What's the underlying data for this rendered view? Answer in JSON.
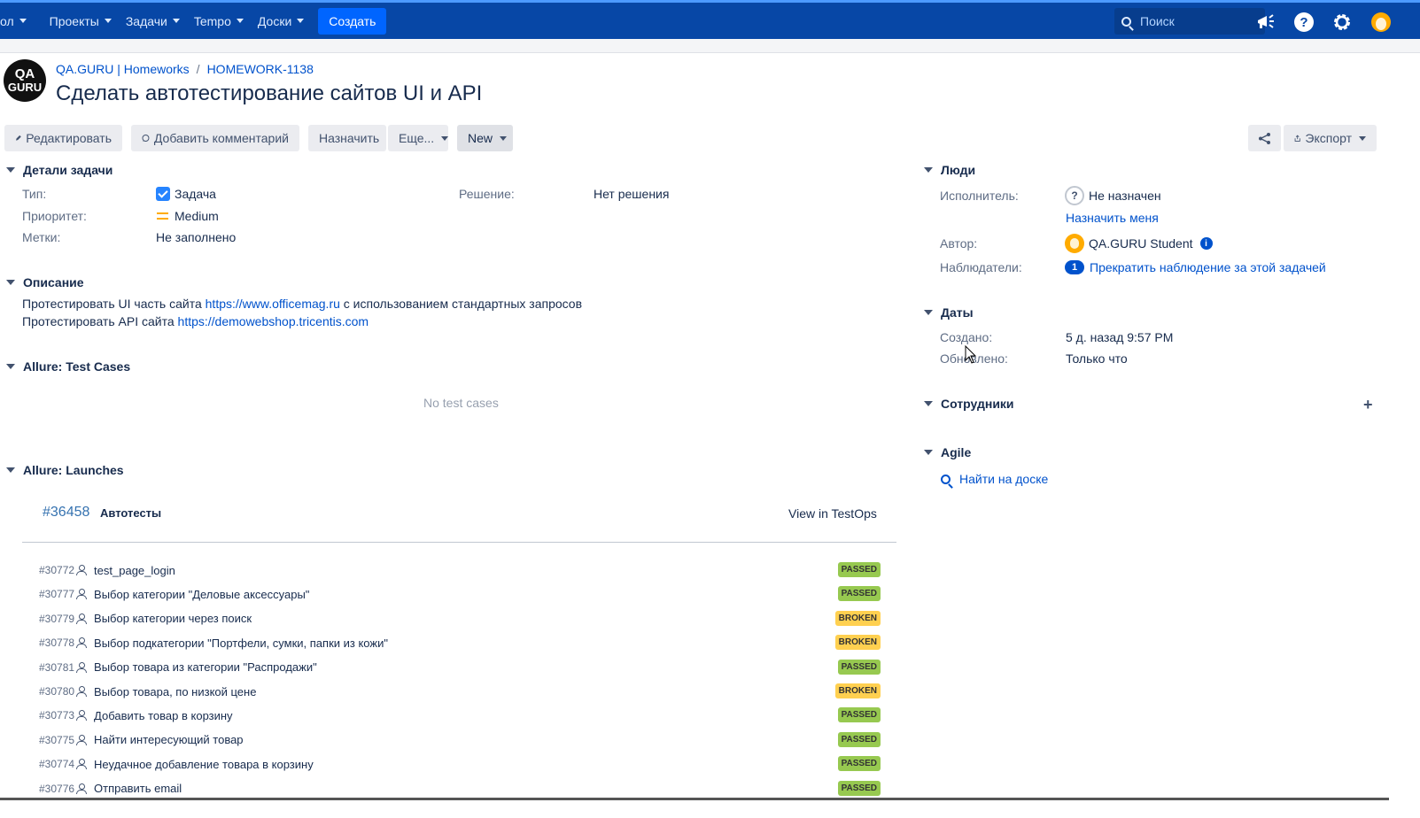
{
  "nav": {
    "items": [
      {
        "label": "ол"
      },
      {
        "label": "Проекты"
      },
      {
        "label": "Задачи"
      },
      {
        "label": "Tempo"
      },
      {
        "label": "Доски"
      }
    ],
    "create_label": "Создать",
    "search_placeholder": "Поиск",
    "icons": [
      "megaphone-icon",
      "help-icon",
      "settings-icon",
      "user-avatar"
    ]
  },
  "breadcrumb": {
    "project": "QA.GURU | Homeworks",
    "issue_key": "HOMEWORK-1138"
  },
  "project_logo_text": [
    "QA",
    "GURU"
  ],
  "issue": {
    "title": "Сделать автотестирование сайтов UI и API"
  },
  "toolbar": {
    "edit_label": "Редактировать",
    "comment_label": "Добавить комментарий",
    "assign_label": "Назначить",
    "more_label": "Еще...",
    "status_label": "New",
    "export_label": "Экспорт"
  },
  "details": {
    "heading": "Детали задачи",
    "type_label": "Тип:",
    "type_value": "Задача",
    "priority_label": "Приоритет:",
    "priority_value": "Medium",
    "labels_label": "Метки:",
    "labels_value": "Не заполнено",
    "resolution_label": "Решение:",
    "resolution_value": "Нет решения"
  },
  "description": {
    "heading": "Описание",
    "line1_prefix": "Протестировать UI часть сайта ",
    "line1_link": "https://www.officemag.ru",
    "line1_suffix": " с использованием стандартных запросов",
    "line2_prefix": "Протестировать API сайта ",
    "line2_link": "https://demowebshop.tricentis.com"
  },
  "allure_test_cases": {
    "heading": "Allure: Test Cases",
    "empty_text": "No test cases"
  },
  "allure_launches": {
    "heading": "Allure: Launches",
    "launch_id": "#36458",
    "launch_name": "Автотесты",
    "view_link": "View in TestOps",
    "test_cases": [
      {
        "id": "#30772",
        "name": "test_page_login",
        "status": "PASSED"
      },
      {
        "id": "#30777",
        "name": "Выбор категории \"Деловые аксессуары\"",
        "status": "PASSED"
      },
      {
        "id": "#30779",
        "name": "Выбор категории через поиск",
        "status": "BROKEN"
      },
      {
        "id": "#30778",
        "name": "Выбор подкатегории \"Портфели, сумки, папки из кожи\"",
        "status": "BROKEN"
      },
      {
        "id": "#30781",
        "name": "Выбор товара из категории \"Распродажи\"",
        "status": "PASSED"
      },
      {
        "id": "#30780",
        "name": "Выбор товара, по низкой цене",
        "status": "BROKEN"
      },
      {
        "id": "#30773",
        "name": "Добавить товар в корзину",
        "status": "PASSED"
      },
      {
        "id": "#30775",
        "name": "Найти интересующий товар",
        "status": "PASSED"
      },
      {
        "id": "#30774",
        "name": "Неудачное добавление товара в корзину",
        "status": "PASSED"
      },
      {
        "id": "#30776",
        "name": "Отправить email",
        "status": "PASSED"
      }
    ]
  },
  "people": {
    "heading": "Люди",
    "assignee_label": "Исполнитель:",
    "assignee_value": "Не назначен",
    "assign_me": "Назначить меня",
    "reporter_label": "Автор:",
    "reporter_value": "QA.GURU Student",
    "watchers_label": "Наблюдатели:",
    "watchers_count": "1",
    "watchers_action": "Прекратить наблюдение за этой задачей"
  },
  "dates": {
    "heading": "Даты",
    "created_label": "Создано:",
    "created_value": "5 д. назад 9:57 PM",
    "updated_label": "Обновлено:",
    "updated_value": "Только что"
  },
  "employees": {
    "heading": "Сотрудники"
  },
  "agile": {
    "heading": "Agile",
    "find_on_board": "Найти на доске"
  },
  "colors": {
    "nav_bg": "#0747a6",
    "create_button": "#0065ff",
    "link": "#0052cc",
    "passed": "#97c950",
    "broken": "#ffd050"
  }
}
